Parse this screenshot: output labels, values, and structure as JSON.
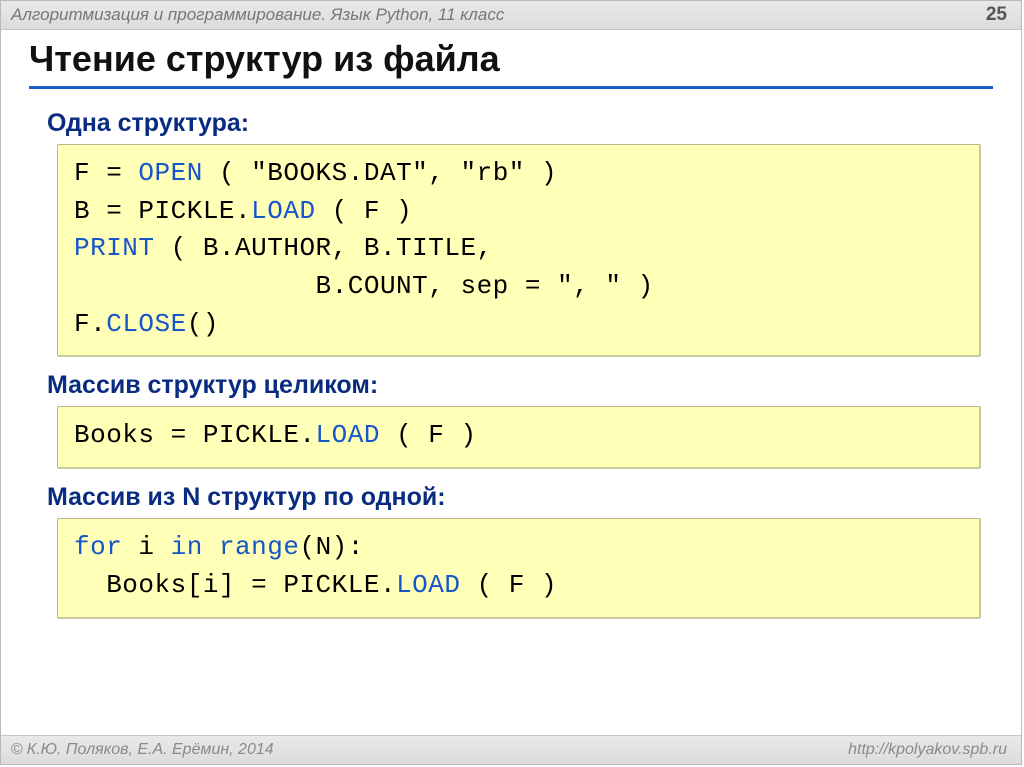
{
  "header": {
    "breadcrumb": "Алгоритмизация и программирование. Язык Python, 11 класс",
    "page_number": "25"
  },
  "title": "Чтение структур из файла",
  "sections": [
    {
      "heading": "Одна структура",
      "colon": ":",
      "code_html": "F = <span class=\"kw\">OPEN</span> ( \"BOOKS.DAT\", \"rb\" )\nB = PICKLE.<span class=\"kw\">LOAD</span> ( F )\n<span class=\"kw\">PRINT</span> ( B.AUTHOR, B.TITLE,\n               B.COUNT, sep = \", \" )\nF.<span class=\"kw\">CLOSE</span>()"
    },
    {
      "heading": "Массив структур целиком",
      "colon": ":",
      "code_html": "Books = PICKLE.<span class=\"kw\">LOAD</span> ( F )"
    },
    {
      "heading": "Массив из N структур по одной",
      "colon": ":",
      "code_html": "<span class=\"kw\">for</span> i <span class=\"kw\">in</span> <span class=\"kw\">range</span>(N):\n  Books[i] = PICKLE.<span class=\"kw\">LOAD</span> ( F )"
    }
  ],
  "footer": {
    "left": "К.Ю. Поляков, Е.А. Ерёмин, 2014",
    "right": "http://kpolyakov.spb.ru"
  }
}
